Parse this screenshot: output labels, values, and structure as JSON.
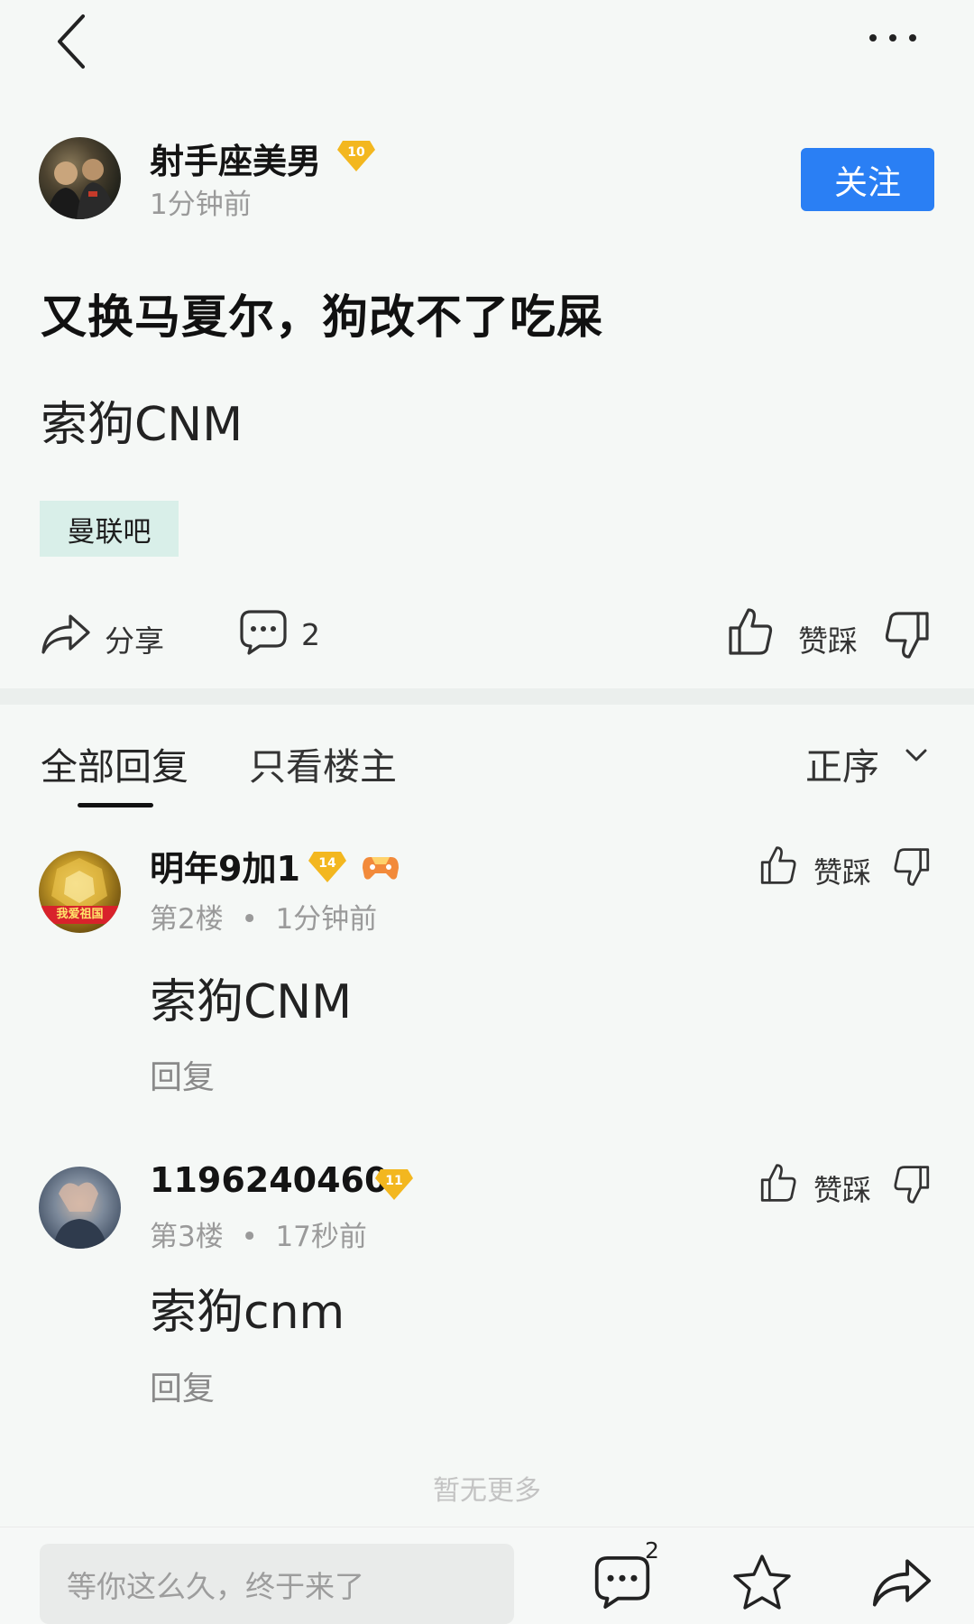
{
  "header": {
    "back_icon": "chevron-left-icon",
    "more_icon": "more-horizontal-icon"
  },
  "author": {
    "name": "射手座美男",
    "level": "10",
    "time": "1分钟前",
    "follow_label": "关注"
  },
  "post": {
    "title": "又换马夏尔，狗改不了吃屎",
    "body": "索狗CNM",
    "forum_tag": "曼联吧"
  },
  "actions": {
    "share_label": "分享",
    "comment_count": "2",
    "like_dislike_label": "赞踩"
  },
  "tabs": {
    "all": "全部回复",
    "owner_only": "只看楼主",
    "sort": "正序"
  },
  "comments": [
    {
      "name": "明年9加1",
      "level": "14",
      "avatar_flag_text": "我爱祖国",
      "floor": "第2楼",
      "time": "1分钟前",
      "text": "索狗CNM",
      "reply_label": "回复",
      "like_dislike_label": "赞踩"
    },
    {
      "name": "1196240460",
      "level": "11",
      "floor": "第3楼",
      "time": "17秒前",
      "text": "索狗cnm",
      "reply_label": "回复",
      "like_dislike_label": "赞踩"
    }
  ],
  "footer": {
    "no_more": "暂无更多",
    "input_placeholder": "等你这么久，终于来了",
    "comment_badge": "2"
  },
  "colors": {
    "accent": "#2a7ff4",
    "background": "#f5f8f6",
    "tag_background": "#d9efe9",
    "badge_gold": "#f3b71f"
  }
}
